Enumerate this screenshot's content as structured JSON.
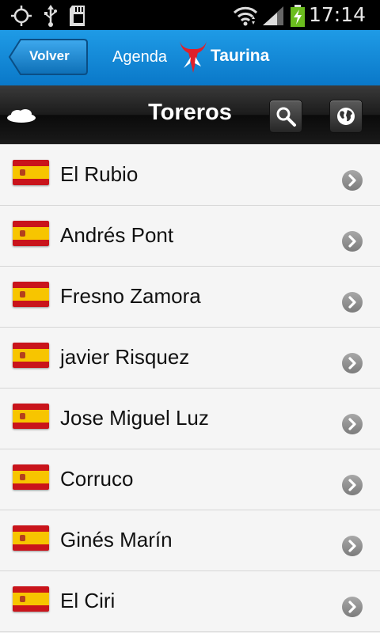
{
  "status_bar": {
    "time": "17:14",
    "icons": [
      "gps-icon",
      "usb-icon",
      "sd-card-icon",
      "wifi-icon",
      "signal-icon",
      "battery-charging-icon"
    ]
  },
  "app_bar": {
    "back_label": "Volver",
    "logo_text_1": "Agenda",
    "logo_text_2": "Taurina",
    "accent_color": "#0a78c8"
  },
  "title_bar": {
    "title": "Toreros",
    "icons": [
      "cloud-icon",
      "search-icon",
      "globe-icon"
    ]
  },
  "toreros": [
    {
      "name": "El Rubio",
      "flag": "spain-flag-icon"
    },
    {
      "name": "Andrés Pont",
      "flag": "spain-flag-icon"
    },
    {
      "name": "Fresno Zamora",
      "flag": "spain-flag-icon"
    },
    {
      "name": "javier Risquez",
      "flag": "spain-flag-icon"
    },
    {
      "name": "Jose Miguel Luz",
      "flag": "spain-flag-icon"
    },
    {
      "name": "Corruco",
      "flag": "spain-flag-icon"
    },
    {
      "name": "Ginés Marín",
      "flag": "spain-flag-icon"
    },
    {
      "name": "El Ciri",
      "flag": "spain-flag-icon"
    }
  ]
}
